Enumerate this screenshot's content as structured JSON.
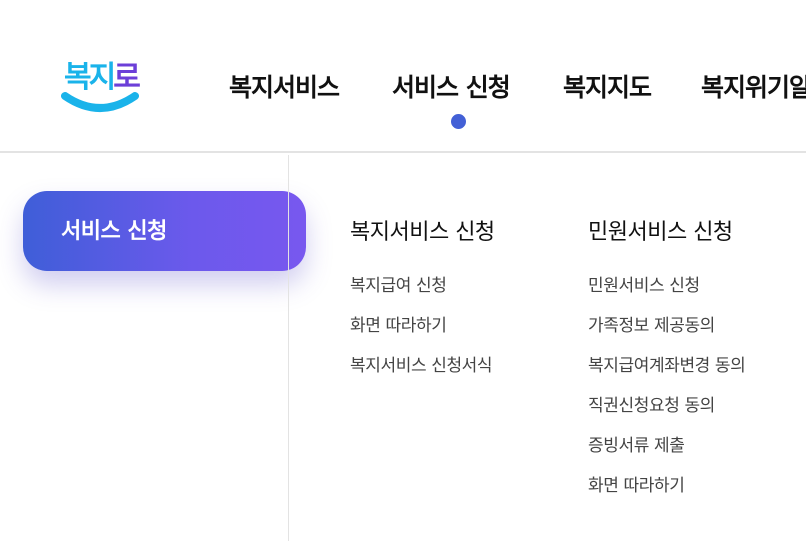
{
  "logo": {
    "text_1": "복",
    "text_2": "지",
    "text_3": "로"
  },
  "gnb": {
    "items": [
      {
        "label": "복지서비스"
      },
      {
        "label": "서비스 신청"
      },
      {
        "label": "복지지도"
      },
      {
        "label": "복지위기알림"
      }
    ],
    "active_index": 1
  },
  "side": {
    "active_label": "서비스 신청"
  },
  "menu": {
    "columns": [
      {
        "title": "복지서비스 신청",
        "items": [
          "복지급여 신청",
          "화면 따라하기",
          "복지서비스 신청서식"
        ]
      },
      {
        "title": "민원서비스 신청",
        "items": [
          "민원서비스 신청",
          "가족정보 제공동의",
          "복지급여계좌변경 동의",
          "직권신청요청 동의",
          "증빙서류 제출",
          "화면 따라하기"
        ]
      }
    ]
  },
  "colors": {
    "accent": "#4360d6",
    "gradient_start": "#3f5ed8",
    "gradient_end": "#7858ef",
    "logo_blue": "#1ab3ea",
    "logo_purple": "#6c3fd8"
  }
}
